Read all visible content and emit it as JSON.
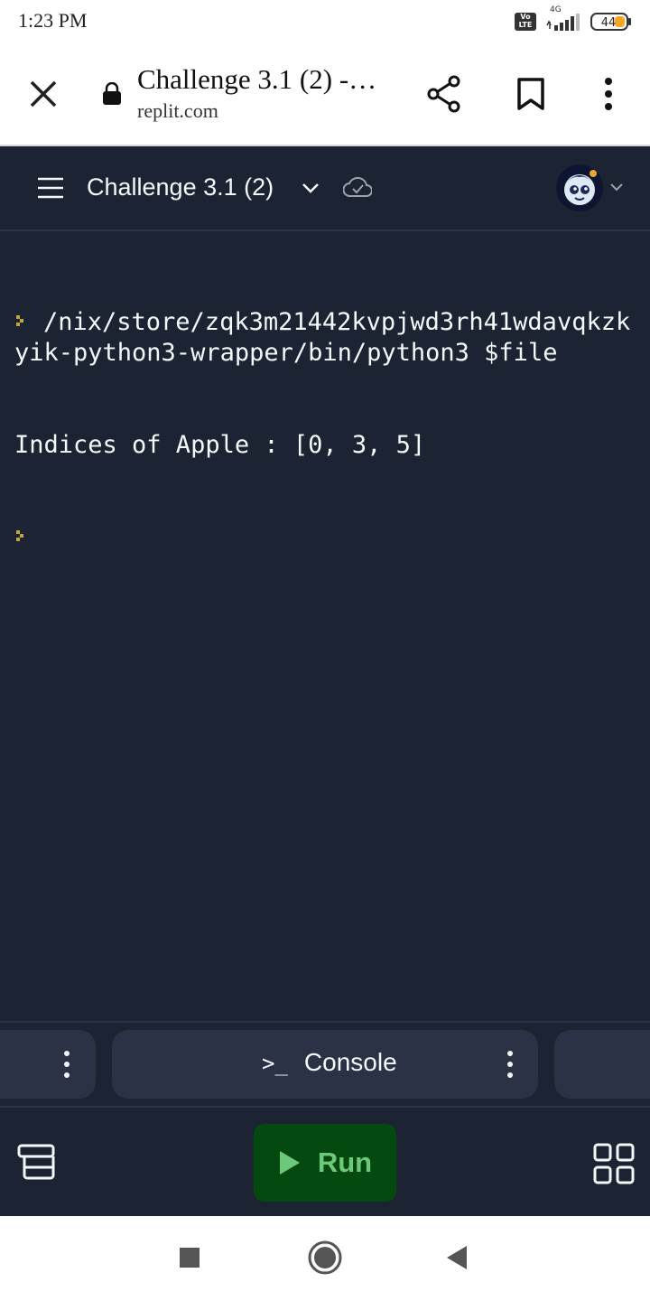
{
  "status_bar": {
    "time": "1:23 PM",
    "volte": "Vo LTE",
    "network": "4G",
    "battery": "44"
  },
  "browser": {
    "page_title": "Challenge 3.1 (2) -…",
    "url": "replit.com",
    "icons": [
      "close-icon",
      "lock-icon",
      "share-icon",
      "bookmark-icon",
      "more-vert-icon"
    ]
  },
  "app_header": {
    "repl_name": "Challenge 3.1 (2)",
    "icons": [
      "menu-icon",
      "chevron-down-icon",
      "cloud-check-icon",
      "avatar",
      "chevron-down-icon"
    ]
  },
  "console": {
    "lines": [
      "/nix/store/zqk3m21442kvpjwd3rh41wdavqkzkyik-python3-wrapper/bin/python3 $file",
      "Indices of Apple : [0, 3, 5]"
    ],
    "prompt_color": "#c7a73b"
  },
  "tabs": {
    "console_label": "Console",
    "console_prefix": ">_"
  },
  "toolbar": {
    "run_label": "Run",
    "run_color": "#6ec87a",
    "run_bg": "#044a10"
  },
  "colors": {
    "background": "#1c2333",
    "surface": "#2b3245",
    "text": "#f5f9fc"
  }
}
